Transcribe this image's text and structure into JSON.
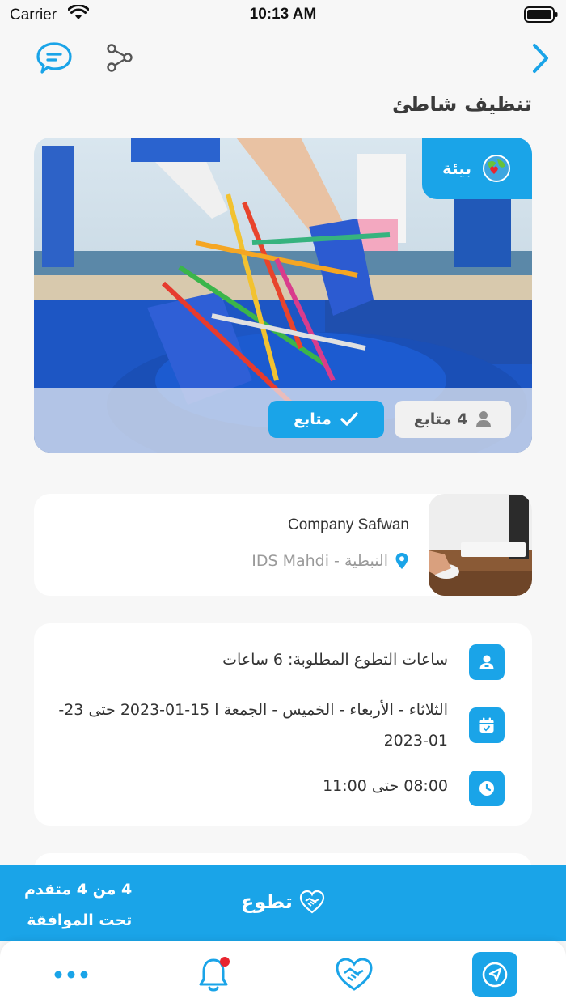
{
  "status_bar": {
    "carrier": "Carrier",
    "time": "10:13 AM"
  },
  "page": {
    "title": "تنظيف شاطئ"
  },
  "hero": {
    "category": "بيئة",
    "followers": "4 متابع",
    "follow_label": "متابع"
  },
  "organization": {
    "name": "Company Safwan",
    "location": "النبطية - IDS Mahdi"
  },
  "details": {
    "hours": "ساعات التطوع المطلوبة: 6 ساعات",
    "days": "الثلاثاء - الأربعاء - الخميس - الجمعة ا 15-01-2023 حتى 23-01-2023",
    "time": "08:00 حتى 11:00"
  },
  "volunteer_bar": {
    "applicants_line1": "4 من 4 متقدم",
    "applicants_line2": "تحت الموافقة",
    "volunteer_label": "تطوع"
  },
  "icons": {
    "chat": "chat-bubble-icon",
    "share": "share-icon",
    "back": "chevron-right-icon",
    "category": "earth-heart-icon",
    "followers": "person-icon",
    "follow": "checkmark-icon",
    "location": "location-pin-icon",
    "hours": "person-badge-icon",
    "days": "calendar-icon",
    "time": "clock-icon",
    "volunteer": "handshake-icon",
    "more": "ellipsis-icon",
    "notifications": "bell-icon",
    "explore": "navigation-arrow-icon"
  },
  "colors": {
    "accent": "#1aa4e8",
    "notification_dot": "#e8242f"
  }
}
